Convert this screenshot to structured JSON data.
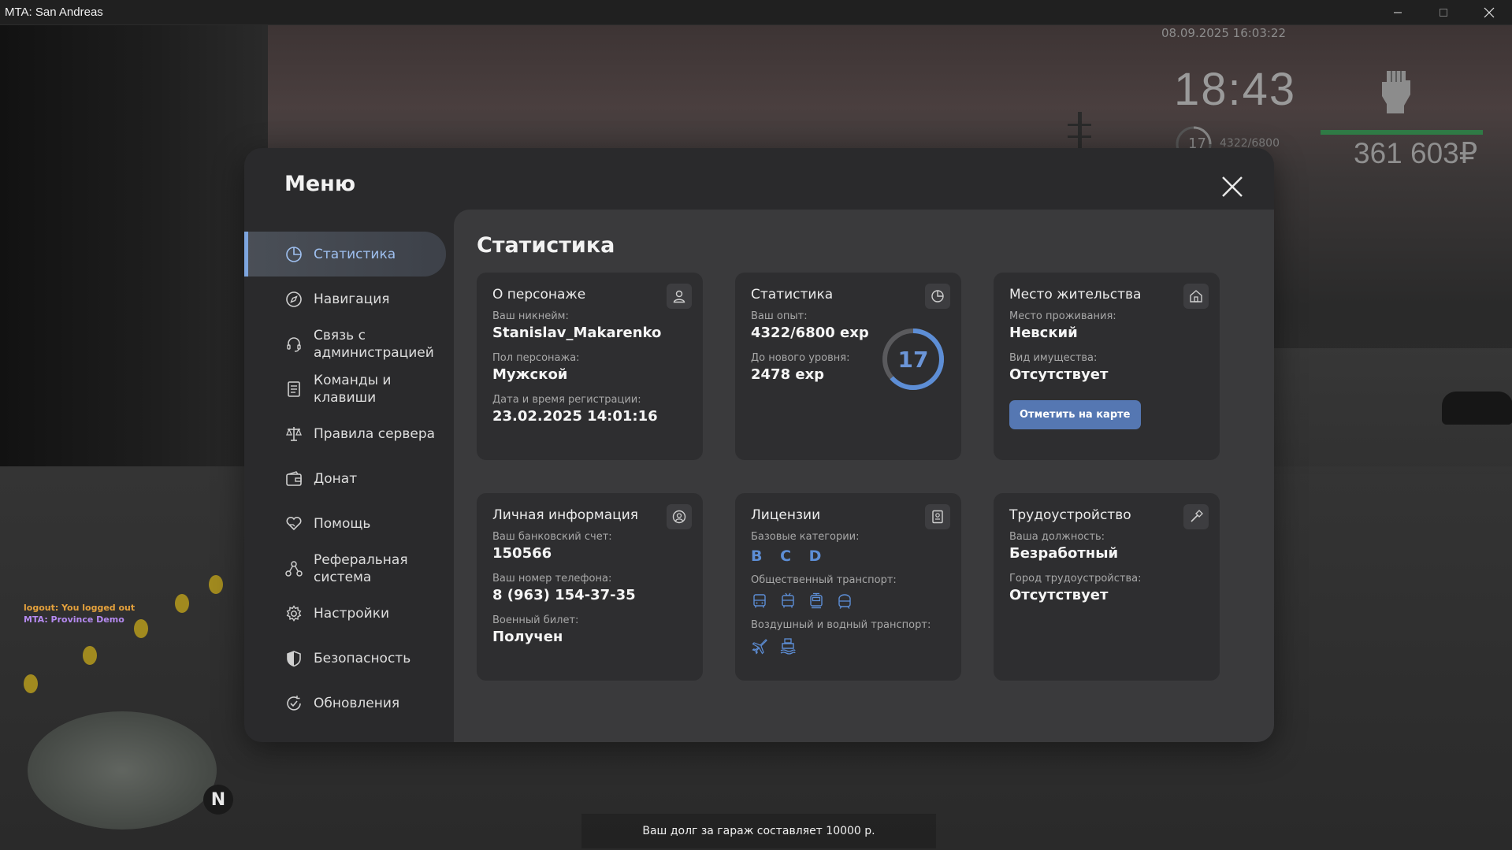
{
  "window": {
    "title": "MTA: San Andreas"
  },
  "hud": {
    "datetime": "08.09.2025 16:03:22",
    "time": "18:43",
    "level": "17",
    "exp": "4322/6800",
    "money": "361 603₽",
    "health_color": "#2f7a45"
  },
  "chat": {
    "line1": "logout: You logged out",
    "line2": "MTA: Province Demo"
  },
  "radar": {
    "north": "N"
  },
  "notification": "Ваш долг за гараж составляет 10000 р.",
  "menu": {
    "title": "Меню",
    "close_icon": "close-icon",
    "sidebar": [
      {
        "label": "Статистика",
        "icon": "pie-chart-icon",
        "active": true
      },
      {
        "label": "Навигация",
        "icon": "compass-icon"
      },
      {
        "label": "Связь с администрацией",
        "icon": "headset-icon"
      },
      {
        "label": "Команды и клавиши",
        "icon": "document-icon"
      },
      {
        "label": "Правила сервера",
        "icon": "scales-icon"
      },
      {
        "label": "Донат",
        "icon": "wallet-icon"
      },
      {
        "label": "Помощь",
        "icon": "heart-hand-icon"
      },
      {
        "label": "Реферальная система",
        "icon": "referral-icon"
      },
      {
        "label": "Настройки",
        "icon": "gear-icon"
      },
      {
        "label": "Безопасность",
        "icon": "shield-icon"
      },
      {
        "label": "Обновления",
        "icon": "refresh-check-icon"
      }
    ],
    "content_title": "Статистика",
    "accent_color": "#5d8ed6",
    "cards": {
      "character": {
        "title": "О персонаже",
        "nickname_label": "Ваш никнейм:",
        "nickname": "Stanislav_Makarenko",
        "gender_label": "Пол персонажа:",
        "gender": "Мужской",
        "reg_label": "Дата и время регистрации:",
        "reg": "23.02.2025 14:01:16"
      },
      "stats": {
        "title": "Статистика",
        "exp_label": "Ваш опыт:",
        "exp": "4322/6800 exp",
        "next_label": "До нового уровня:",
        "next": "2478 exp",
        "level": "17",
        "level_progress": 0.636
      },
      "residence": {
        "title": "Место жительства",
        "place_label": "Место проживания:",
        "place": "Невский",
        "property_label": "Вид имущества:",
        "property": "Отсутствует",
        "button": "Отметить на карте"
      },
      "personal": {
        "title": "Личная информация",
        "bank_label": "Ваш банковский счет:",
        "bank": "150566",
        "phone_label": "Ваш номер телефона:",
        "phone": "8 (963) 154-37-35",
        "military_label": "Военный билет:",
        "military": "Получен"
      },
      "licenses": {
        "title": "Лицензии",
        "base_label": "Базовые категории:",
        "base": "B C D",
        "public_label": "Общественный транспорт:",
        "public_icons": [
          "bus-icon",
          "trolleybus-icon",
          "tram-icon",
          "metro-icon"
        ],
        "air_label": "Воздушный и водный транспорт:",
        "air_icons": [
          "plane-icon",
          "boat-icon"
        ]
      },
      "employment": {
        "title": "Трудоустройство",
        "position_label": "Ваша должность:",
        "position": "Безработный",
        "city_label": "Город трудоустройства:",
        "city": "Отсутствует"
      }
    }
  }
}
